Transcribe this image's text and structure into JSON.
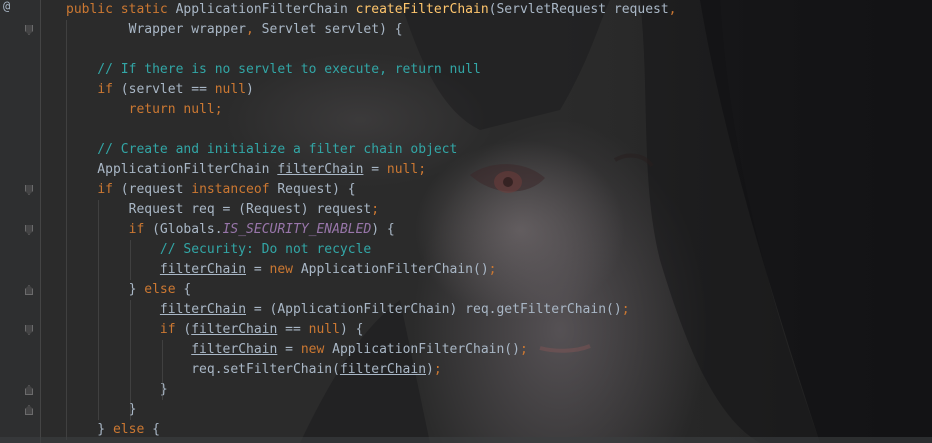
{
  "editor": {
    "gutter_marker": "@",
    "lines": [
      [
        {
          "t": "public static ",
          "c": "kw"
        },
        {
          "t": "ApplicationFilterChain ",
          "c": ""
        },
        {
          "t": "createFilterChain",
          "c": "fn"
        },
        {
          "t": "(ServletRequest request",
          "c": ""
        },
        {
          "t": ",",
          "c": "kw"
        }
      ],
      [
        {
          "t": "        Wrapper wrapper",
          "c": ""
        },
        {
          "t": ", ",
          "c": "kw"
        },
        {
          "t": "Servlet servlet) {",
          "c": ""
        }
      ],
      [],
      [
        {
          "t": "    // If there is no servlet to execute, return null",
          "c": "cmt"
        }
      ],
      [
        {
          "t": "    ",
          "c": ""
        },
        {
          "t": "if ",
          "c": "kw"
        },
        {
          "t": "(servlet == ",
          "c": ""
        },
        {
          "t": "null",
          "c": "kw"
        },
        {
          "t": ")",
          "c": ""
        }
      ],
      [
        {
          "t": "        ",
          "c": ""
        },
        {
          "t": "return null;",
          "c": "kw"
        }
      ],
      [],
      [
        {
          "t": "    // Create and initialize a filter chain object",
          "c": "cmt"
        }
      ],
      [
        {
          "t": "    ApplicationFilterChain ",
          "c": ""
        },
        {
          "t": "filterChain",
          "c": "field"
        },
        {
          "t": " = ",
          "c": ""
        },
        {
          "t": "null;",
          "c": "kw"
        }
      ],
      [
        {
          "t": "    ",
          "c": ""
        },
        {
          "t": "if ",
          "c": "kw"
        },
        {
          "t": "(request ",
          "c": ""
        },
        {
          "t": "instanceof ",
          "c": "kw"
        },
        {
          "t": "Request) {",
          "c": ""
        }
      ],
      [
        {
          "t": "        Request req = (Request) request",
          "c": ""
        },
        {
          "t": ";",
          "c": "kw"
        }
      ],
      [
        {
          "t": "        ",
          "c": ""
        },
        {
          "t": "if ",
          "c": "kw"
        },
        {
          "t": "(Globals.",
          "c": ""
        },
        {
          "t": "IS_SECURITY_ENABLED",
          "c": "const"
        },
        {
          "t": ") {",
          "c": ""
        }
      ],
      [
        {
          "t": "            // Security: Do not recycle",
          "c": "cmt"
        }
      ],
      [
        {
          "t": "            ",
          "c": ""
        },
        {
          "t": "filterChain",
          "c": "field"
        },
        {
          "t": " = ",
          "c": ""
        },
        {
          "t": "new ",
          "c": "kw"
        },
        {
          "t": "ApplicationFilterChain()",
          "c": ""
        },
        {
          "t": ";",
          "c": "kw"
        }
      ],
      [
        {
          "t": "        } ",
          "c": ""
        },
        {
          "t": "else ",
          "c": "kw"
        },
        {
          "t": "{",
          "c": ""
        }
      ],
      [
        {
          "t": "            ",
          "c": ""
        },
        {
          "t": "filterChain",
          "c": "field"
        },
        {
          "t": " = (ApplicationFilterChain) req.getFilterChain()",
          "c": ""
        },
        {
          "t": ";",
          "c": "kw"
        }
      ],
      [
        {
          "t": "            ",
          "c": ""
        },
        {
          "t": "if ",
          "c": "kw"
        },
        {
          "t": "(",
          "c": ""
        },
        {
          "t": "filterChain",
          "c": "field"
        },
        {
          "t": " == ",
          "c": ""
        },
        {
          "t": "null",
          "c": "kw"
        },
        {
          "t": ") {",
          "c": ""
        }
      ],
      [
        {
          "t": "                ",
          "c": ""
        },
        {
          "t": "filterChain",
          "c": "field"
        },
        {
          "t": " = ",
          "c": ""
        },
        {
          "t": "new ",
          "c": "kw"
        },
        {
          "t": "ApplicationFilterChain()",
          "c": ""
        },
        {
          "t": ";",
          "c": "kw"
        }
      ],
      [
        {
          "t": "                req.setFilterChain(",
          "c": ""
        },
        {
          "t": "filterChain",
          "c": "field"
        },
        {
          "t": ")",
          "c": ""
        },
        {
          "t": ";",
          "c": "kw"
        }
      ],
      [
        {
          "t": "            }",
          "c": ""
        }
      ],
      [
        {
          "t": "        }",
          "c": ""
        }
      ],
      [
        {
          "t": "    } ",
          "c": ""
        },
        {
          "t": "else ",
          "c": "kw"
        },
        {
          "t": "{",
          "c": ""
        }
      ]
    ]
  },
  "colors": {
    "background": "#2b2b2b",
    "keyword": "#cc7832",
    "function": "#ffc66d",
    "comment": "#32a6a6",
    "constant": "#9876aa",
    "text": "#a9b7c6"
  },
  "icons": [
    "override-marker-icon",
    "fold-icon"
  ]
}
